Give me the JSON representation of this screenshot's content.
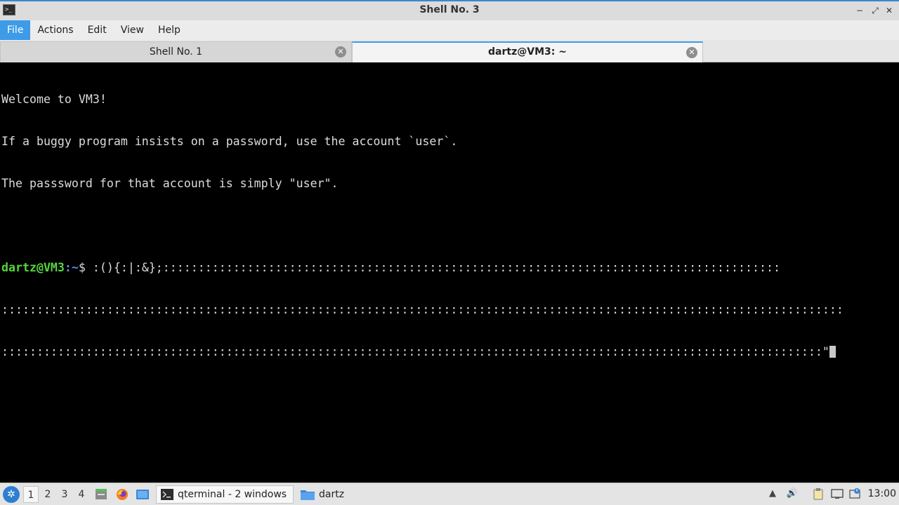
{
  "window": {
    "title": "Shell No. 3",
    "app_icon_glyph": ">_",
    "controls": {
      "minimize": "−",
      "maximize": "⤢",
      "close": "✕"
    }
  },
  "menu": {
    "items": [
      "File",
      "Actions",
      "Edit",
      "View",
      "Help"
    ]
  },
  "tabs": [
    {
      "label": "Shell No. 1",
      "active": false
    },
    {
      "label": "dartz@VM3: ~",
      "active": true
    }
  ],
  "terminal": {
    "lines": [
      "Welcome to VM3!",
      "If a buggy program insists on a password, use the account `user`.",
      "The passsword for that account is simply \"user\".",
      ""
    ],
    "prompt_user_host": "dartz@VM3",
    "prompt_path": ":~",
    "prompt_symbol": "$ ",
    "command_line1": ":(){:|:&};::::::::::::::::::::::::::::::::::::::::::::::::::::::::::::::::::::::::::::::::::::::::",
    "command_line2": "::::::::::::::::::::::::::::::::::::::::::::::::::::::::::::::::::::::::::::::::::::::::::::::::::::::::::::::::::::::::",
    "command_line3": ":::::::::::::::::::::::::::::::::::::::::::::::::::::::::::::::::::::::::::::::::::::::::::::::::::::::::::::::::::::\""
  },
  "taskbar": {
    "desktops": [
      "1",
      "2",
      "3",
      "4"
    ],
    "active_desktop": "1",
    "tasks": [
      {
        "label": "qterminal - 2 windows",
        "icon": "terminal-icon"
      },
      {
        "label": "dartz",
        "icon": "folder-icon"
      }
    ],
    "clock": "13:00"
  },
  "colors": {
    "accent": "#3d9be8",
    "prompt_user": "#57d43f",
    "prompt_path": "#5b8de8",
    "terminal_bg": "#000000",
    "terminal_fg": "#dcdcdc"
  }
}
